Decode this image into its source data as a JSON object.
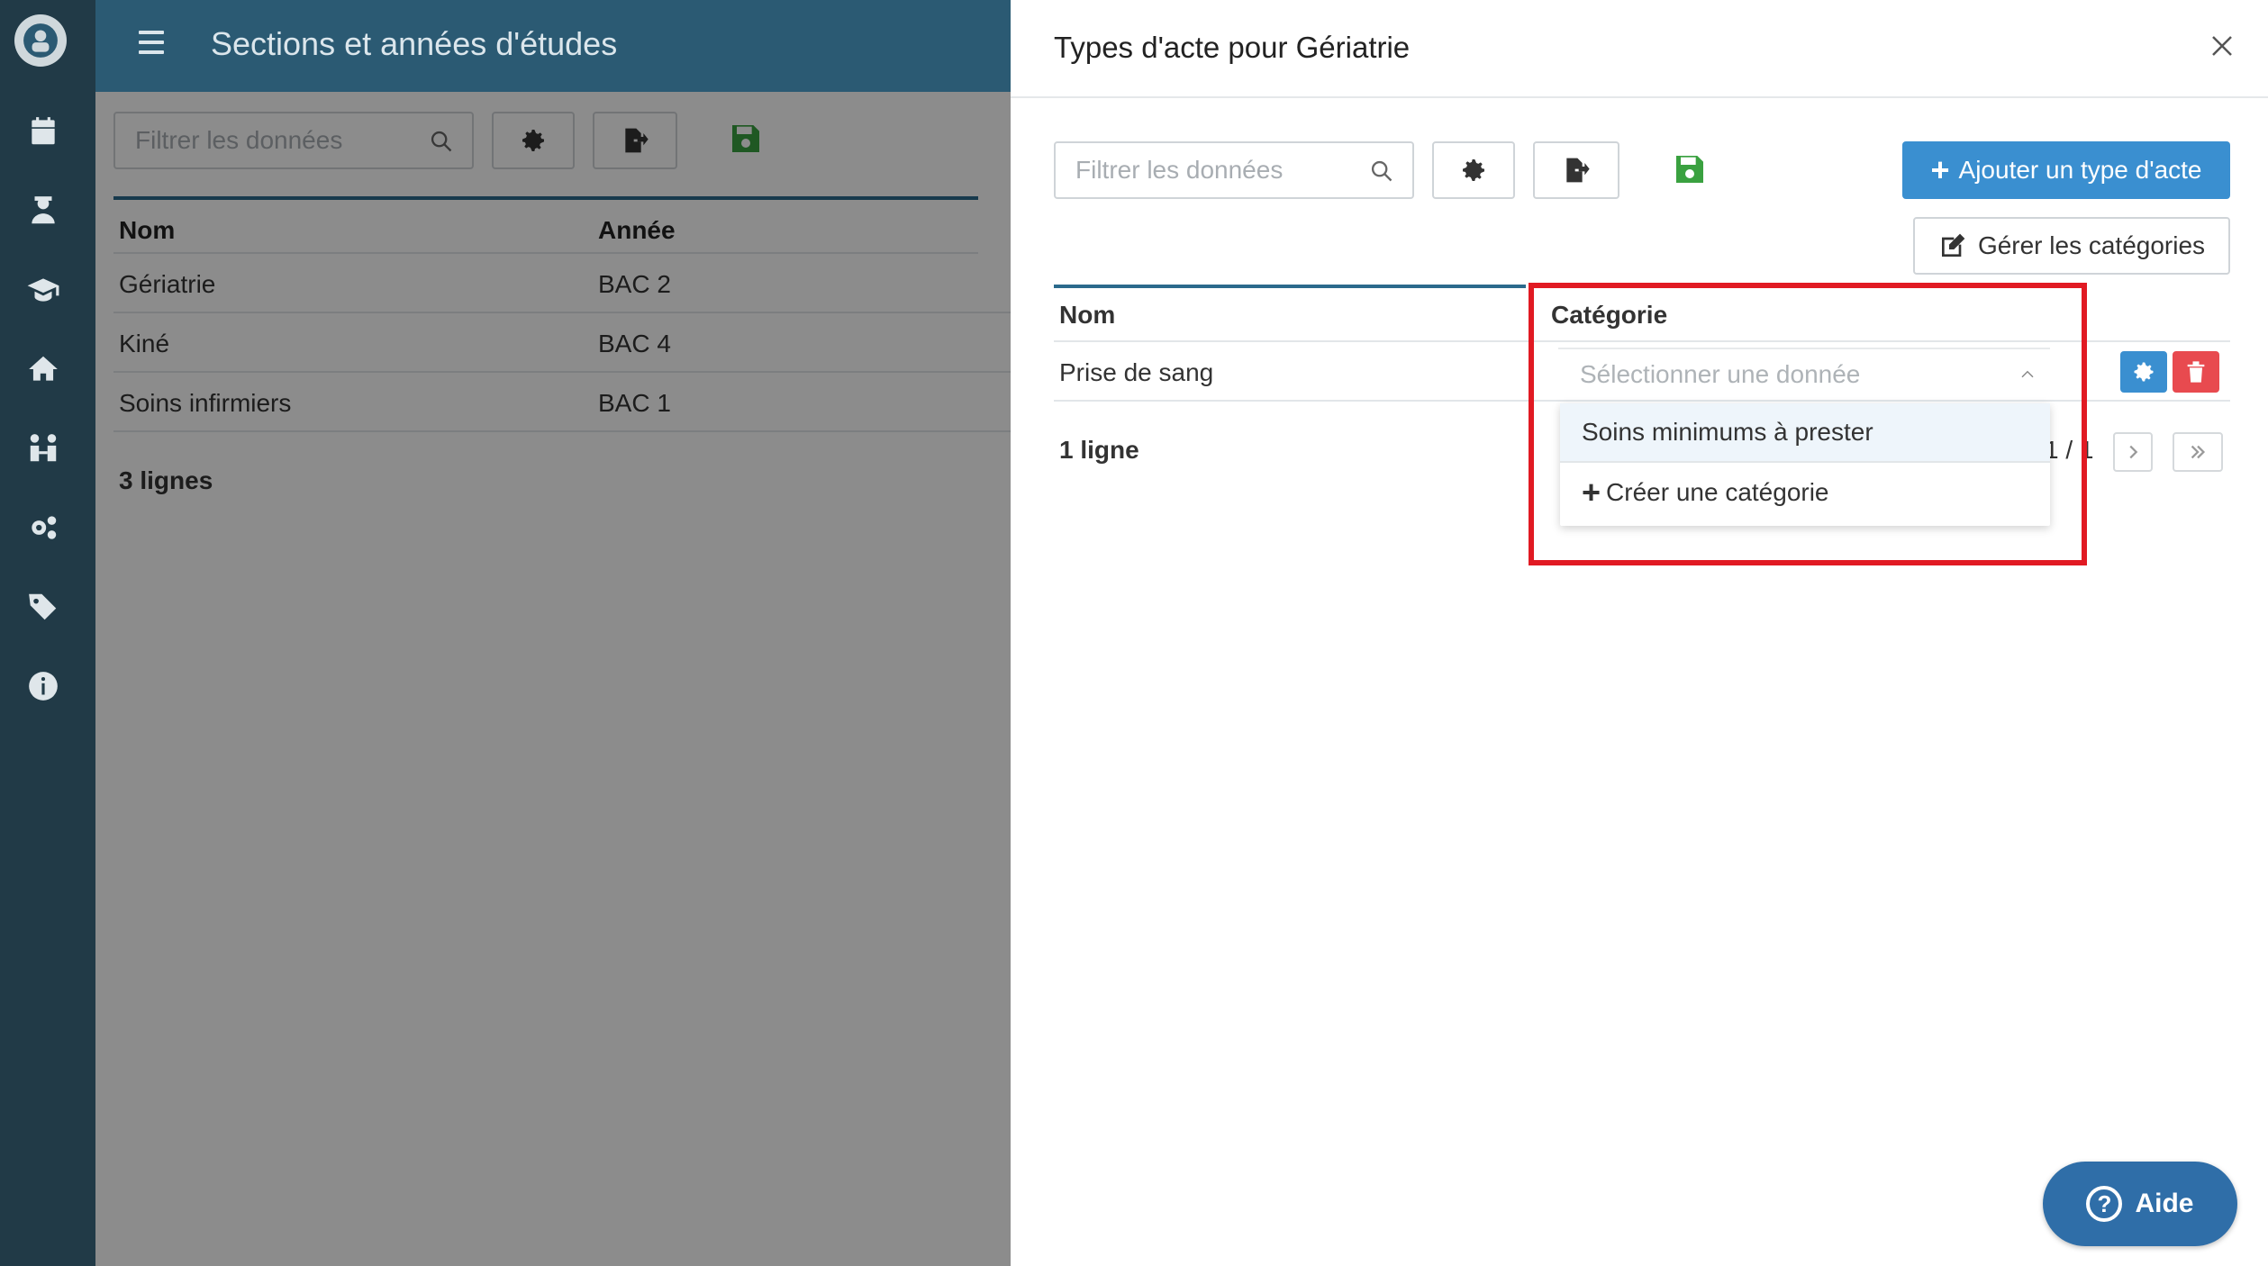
{
  "app": {
    "title": "Sections et années d'études",
    "filter_placeholder": "Filtrer les données",
    "nav_icons": [
      "calendar-icon",
      "student-icon",
      "graduation-cap-icon",
      "home-icon",
      "people-icon",
      "gears-icon",
      "tags-icon",
      "info-icon"
    ]
  },
  "sections_table": {
    "headers": [
      "Nom",
      "Année"
    ],
    "rows": [
      {
        "nom": "Gériatrie",
        "annee": "BAC 2"
      },
      {
        "nom": "Kiné",
        "annee": "BAC 4"
      },
      {
        "nom": "Soins infirmiers",
        "annee": "BAC 1"
      }
    ],
    "count": "3 lignes"
  },
  "drawer": {
    "title": "Types d'acte pour Gériatrie",
    "filter_placeholder": "Filtrer les données",
    "add_button": "Ajouter un type d'acte",
    "manage_button": "Gérer les catégories",
    "headers": [
      "Nom",
      "Catégorie"
    ],
    "rows": [
      {
        "nom": "Prise de sang",
        "categorie_placeholder": "Sélectionner une donnée"
      }
    ],
    "count": "1 ligne",
    "pager": "1 / 1",
    "dropdown_options": [
      "Soins minimums à prester",
      "Créer une catégorie"
    ]
  },
  "help_button": "Aide",
  "colors": {
    "primary": "#3a8fd0",
    "danger": "#e84a4f",
    "sidebar": "#213a47",
    "topbar": "#2b5a73",
    "save": "#3aa140",
    "highlight": "#e11a23"
  }
}
